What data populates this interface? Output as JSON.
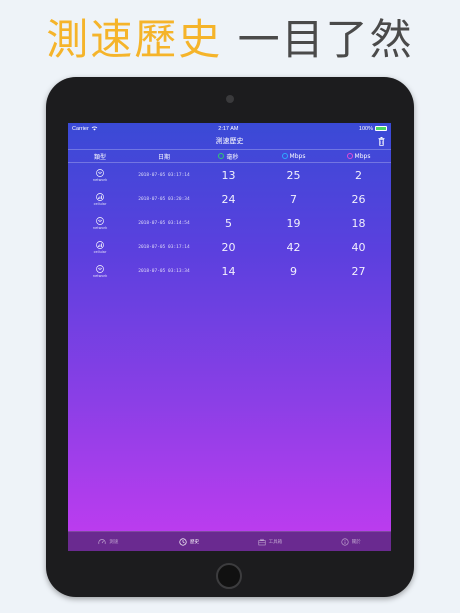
{
  "headline": {
    "part1": "測速歷史",
    "part2": "一目了然"
  },
  "status": {
    "carrier": "Carrier",
    "time": "2:17 AM",
    "battery": "100%"
  },
  "nav": {
    "title": "測速歷史"
  },
  "table": {
    "headers": {
      "type": "類型",
      "date": "日期",
      "ping": "毫秒",
      "download": "Mbps",
      "upload": "Mbps"
    },
    "rows": [
      {
        "type": "wifi",
        "label": "network",
        "date": "2018-07-05 03:17:14",
        "ping": "13",
        "download": "25",
        "upload": "2"
      },
      {
        "type": "cellular",
        "label": "cellular",
        "date": "2018-07-05 03:20:34",
        "ping": "24",
        "download": "7",
        "upload": "26"
      },
      {
        "type": "wifi",
        "label": "network",
        "date": "2018-07-05 03:14:54",
        "ping": "5",
        "download": "19",
        "upload": "18"
      },
      {
        "type": "cellular",
        "label": "cellular",
        "date": "2018-07-05 03:17:14",
        "ping": "20",
        "download": "42",
        "upload": "40"
      },
      {
        "type": "wifi",
        "label": "network",
        "date": "2018-07-05 03:13:34",
        "ping": "14",
        "download": "9",
        "upload": "27"
      }
    ]
  },
  "colors": {
    "ping": "#2ecc71",
    "download": "#2ea8ff",
    "upload": "#e04ad8"
  },
  "tabs": [
    {
      "icon": "speedometer-icon",
      "label": "測速",
      "active": false
    },
    {
      "icon": "clock-icon",
      "label": "歷史",
      "active": true
    },
    {
      "icon": "toolbox-icon",
      "label": "工具箱",
      "active": false
    },
    {
      "icon": "info-icon",
      "label": "關於",
      "active": false
    }
  ]
}
